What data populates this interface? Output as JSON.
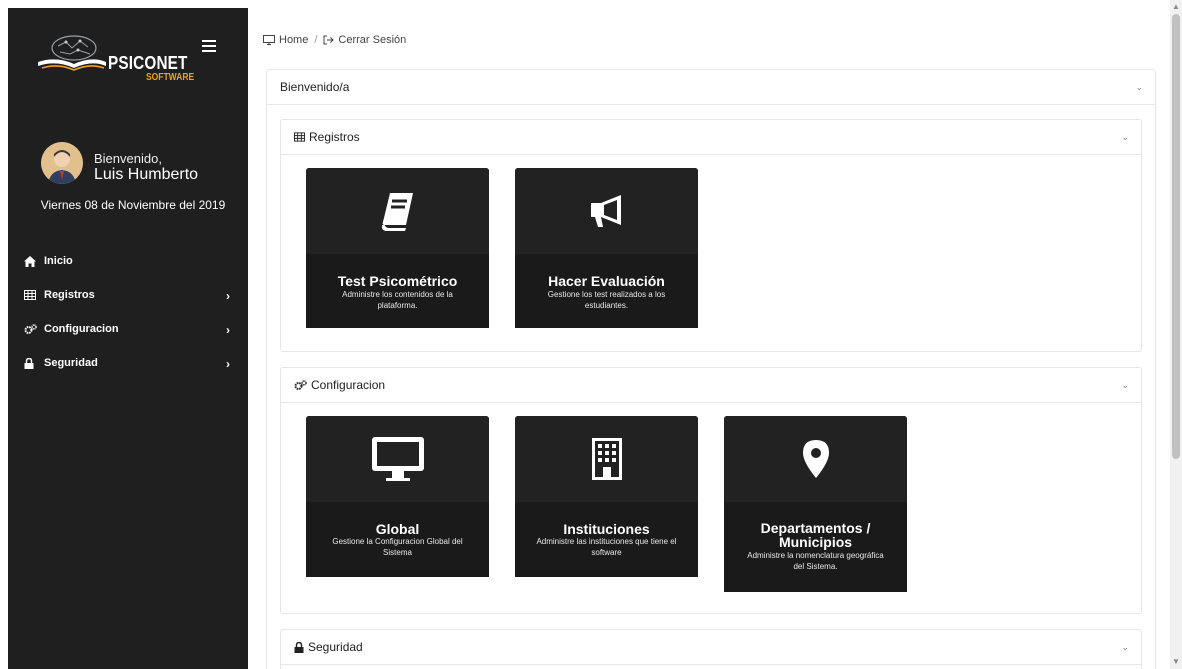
{
  "brand": {
    "name": "PSICONET",
    "sub": "SOFTWARE"
  },
  "profile": {
    "welcome": "Bienvenido,",
    "name": "Luis Humberto",
    "date": "Viernes 08 de Noviembre del 2019"
  },
  "menu": [
    {
      "label": "Inicio",
      "icon": "home-icon"
    },
    {
      "label": "Registros",
      "icon": "table-icon"
    },
    {
      "label": "Configuracion",
      "icon": "cogs-icon"
    },
    {
      "label": "Seguridad",
      "icon": "lock-icon"
    }
  ],
  "breadcrumb": {
    "home": "Home",
    "separator": "/",
    "logout": "Cerrar Sesión"
  },
  "welcome_panel": {
    "title": "Bienvenido/a"
  },
  "registros_panel": {
    "title": "Registros",
    "tiles": [
      {
        "title": "Test Psicométrico",
        "desc": "Administre los contenidos de la plataforma.",
        "icon": "book-icon"
      },
      {
        "title": "Hacer Evaluación",
        "desc": "Gestione los test realizados a los estudiantes.",
        "icon": "megaphone-icon"
      }
    ]
  },
  "config_panel": {
    "title": "Configuracion",
    "tiles": [
      {
        "title": "Global",
        "desc": "Gestione la Configuracion Global del Sistema",
        "icon": "monitor-icon"
      },
      {
        "title": "Instituciones",
        "desc": "Administre las instituciones que tiene el software",
        "icon": "building-icon"
      },
      {
        "title": "Departamentos / Municipios",
        "desc": "Administre la nomenclatura geográfica del Sistema.",
        "icon": "map-marker-icon"
      }
    ]
  },
  "seguridad_panel": {
    "title": "Seguridad"
  },
  "colors": {
    "sidebar": "#1f1f1f",
    "tile": "#1a1a1a",
    "brand_accent": "#f0a020"
  }
}
